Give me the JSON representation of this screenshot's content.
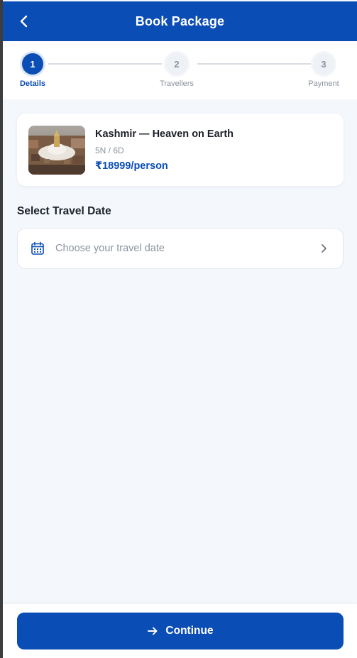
{
  "header": {
    "title": "Book Package",
    "back_icon": "chevron-left-icon"
  },
  "stepper": {
    "steps": [
      {
        "number": "1",
        "label": "Details",
        "state": "active"
      },
      {
        "number": "2",
        "label": "Travellers",
        "state": "inactive"
      },
      {
        "number": "3",
        "label": "Payment",
        "state": "inactive"
      }
    ]
  },
  "package": {
    "title": "Kashmir — Heaven on Earth",
    "duration": "5N / 6D",
    "price": "₹18999/person"
  },
  "travel_date": {
    "section_title": "Select Travel Date",
    "placeholder": "Choose your travel date",
    "icon": "calendar-icon"
  },
  "footer": {
    "continue_label": "Continue",
    "icon": "arrow-right-icon"
  },
  "colors": {
    "primary": "#0a4db5",
    "background": "#f4f7fb",
    "muted": "#8b93a0"
  }
}
